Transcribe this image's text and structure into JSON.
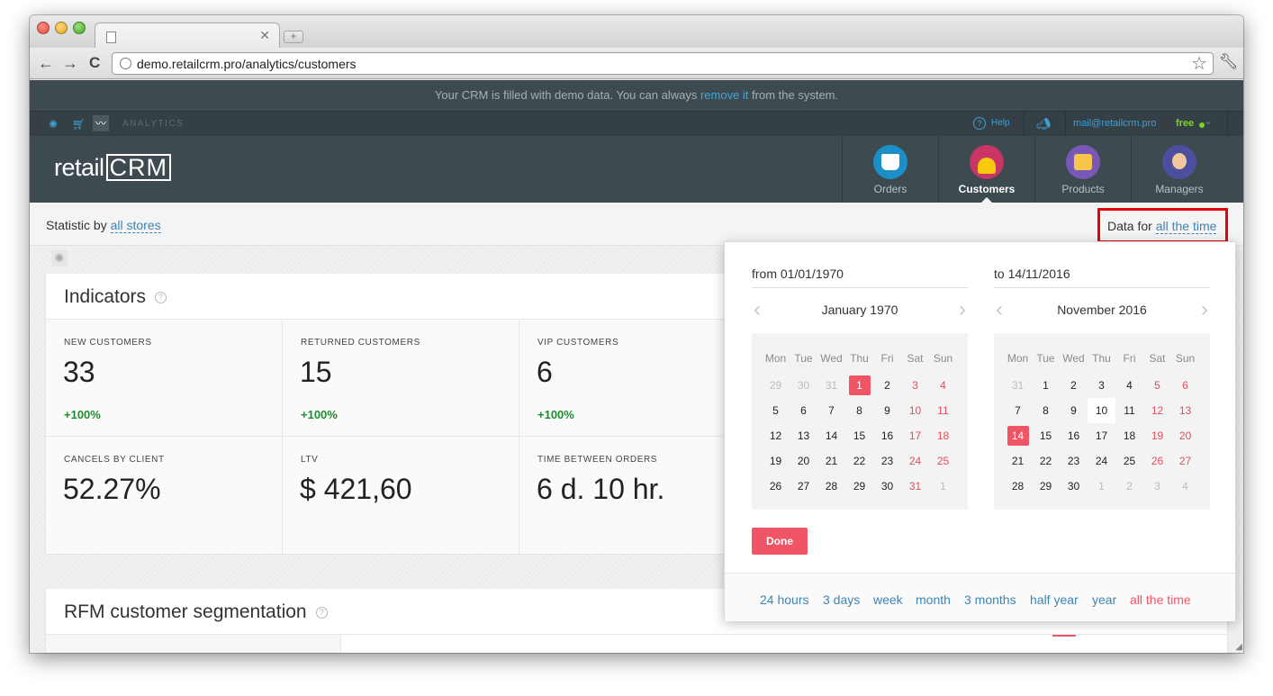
{
  "browser": {
    "url": "demo.retailcrm.pro/analytics/customers",
    "icons": [
      "back-icon",
      "forward-icon",
      "reload-icon",
      "globe-icon",
      "star-icon",
      "wrench-icon"
    ]
  },
  "demo_bar": {
    "prefix": "Your CRM is filled with demo data. You can always",
    "link": "remove it",
    "suffix": "from the system."
  },
  "app_nav": {
    "section": "ANALYTICS",
    "help": "Help",
    "user_email": "mail@retailcrm.pro",
    "plan": "free"
  },
  "header": {
    "logo_left": "retail",
    "logo_right": "CRM",
    "modules": [
      {
        "label": "Orders",
        "active": false
      },
      {
        "label": "Customers",
        "active": true
      },
      {
        "label": "Products",
        "active": false
      },
      {
        "label": "Managers",
        "active": false
      }
    ]
  },
  "statbar": {
    "prefix": "Statistic by",
    "stores_link": "all stores",
    "data_prefix": "Data for",
    "data_link": "all the time"
  },
  "indicators": {
    "title": "Indicators",
    "items": [
      {
        "label": "NEW CUSTOMERS",
        "value": "33",
        "delta": "+100%"
      },
      {
        "label": "RETURNED CUSTOMERS",
        "value": "15",
        "delta": "+100%"
      },
      {
        "label": "VIP CUSTOMERS",
        "value": "6",
        "delta": "+100%"
      },
      {
        "label": "CANCELS BY CLIENT",
        "value": "52.27%",
        "delta": ""
      },
      {
        "label": "LTV",
        "value": "$ 421,60",
        "delta": ""
      },
      {
        "label": "TIME BETWEEN ORDERS",
        "value": "6 d. 10 hr.",
        "delta": ""
      }
    ]
  },
  "rfm": {
    "title": "RFM customer segmentation"
  },
  "datepicker": {
    "from_label": "from",
    "from_value": "01/01/1970",
    "to_label": "to",
    "to_value": "14/11/2016",
    "weekdays": [
      "Mon",
      "Tue",
      "Wed",
      "Thu",
      "Fri",
      "Sat",
      "Sun"
    ],
    "left_month": "January 1970",
    "right_month": "November 2016",
    "left_weeks": [
      [
        "29",
        "30",
        "31",
        "1",
        "2",
        "3",
        "4"
      ],
      [
        "5",
        "6",
        "7",
        "8",
        "9",
        "10",
        "11"
      ],
      [
        "12",
        "13",
        "14",
        "15",
        "16",
        "17",
        "18"
      ],
      [
        "19",
        "20",
        "21",
        "22",
        "23",
        "24",
        "25"
      ],
      [
        "26",
        "27",
        "28",
        "29",
        "30",
        "31",
        "1"
      ]
    ],
    "right_weeks": [
      [
        "31",
        "1",
        "2",
        "3",
        "4",
        "5",
        "6"
      ],
      [
        "7",
        "8",
        "9",
        "10",
        "11",
        "12",
        "13"
      ],
      [
        "14",
        "15",
        "16",
        "17",
        "18",
        "19",
        "20"
      ],
      [
        "21",
        "22",
        "23",
        "24",
        "25",
        "26",
        "27"
      ],
      [
        "28",
        "29",
        "30",
        "1",
        "2",
        "3",
        "4"
      ]
    ],
    "left_selected": "1",
    "right_selected": "14",
    "right_today": "10",
    "done": "Done",
    "presets": [
      "24 hours",
      "3 days",
      "week",
      "month",
      "3 months",
      "half year",
      "year",
      "all the time"
    ],
    "active_preset": "all the time",
    "colors": {
      "accent": "#f05566",
      "link": "#3a86b7",
      "weekend": "#e0505d"
    }
  }
}
